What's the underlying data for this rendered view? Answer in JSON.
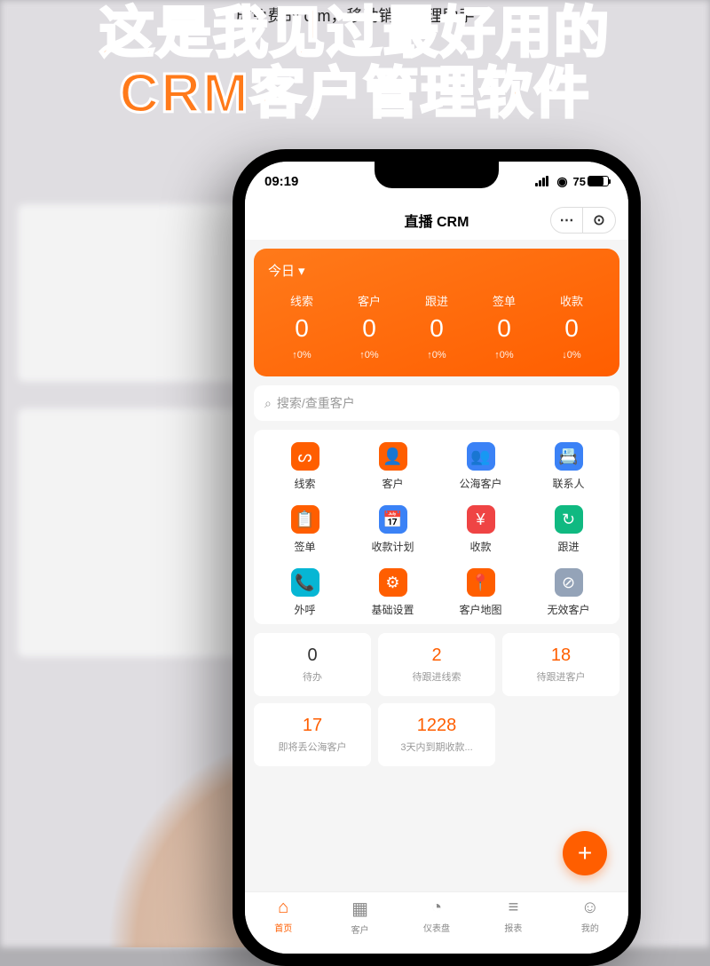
{
  "caption": "成免费的 crm，移动销售管理助手",
  "headline_l1": "这是我见过最好用的",
  "headline_l2": "CRM客户管理软件",
  "status": {
    "time": "09:19",
    "battery": "75"
  },
  "app_title": "直播 CRM",
  "hero": {
    "day": "今日",
    "stats": [
      {
        "label": "线索",
        "value": "0",
        "change": "↑0%"
      },
      {
        "label": "客户",
        "value": "0",
        "change": "↑0%"
      },
      {
        "label": "跟进",
        "value": "0",
        "change": "↑0%"
      },
      {
        "label": "签单",
        "value": "0",
        "change": "↑0%"
      },
      {
        "label": "收款",
        "value": "0",
        "change": "↓0%"
      }
    ]
  },
  "search_placeholder": "搜索/查重客户",
  "grid": [
    {
      "label": "线索",
      "bg": "#ff5e00",
      "glyph": "ᔕ"
    },
    {
      "label": "客户",
      "bg": "#ff5e00",
      "glyph": "👤"
    },
    {
      "label": "公海客户",
      "bg": "#3b82f6",
      "glyph": "👥"
    },
    {
      "label": "联系人",
      "bg": "#3b82f6",
      "glyph": "📇"
    },
    {
      "label": "签单",
      "bg": "#ff5e00",
      "glyph": "📋"
    },
    {
      "label": "收款计划",
      "bg": "#3b82f6",
      "glyph": "📅"
    },
    {
      "label": "收款",
      "bg": "#ef4444",
      "glyph": "¥"
    },
    {
      "label": "跟进",
      "bg": "#10b981",
      "glyph": "↻"
    },
    {
      "label": "外呼",
      "bg": "#06b6d4",
      "glyph": "📞"
    },
    {
      "label": "基础设置",
      "bg": "#ff5e00",
      "glyph": "⚙"
    },
    {
      "label": "客户地图",
      "bg": "#ff5e00",
      "glyph": "📍"
    },
    {
      "label": "无效客户",
      "bg": "#94a3b8",
      "glyph": "⊘"
    }
  ],
  "cards": [
    {
      "value": "0",
      "label": "待办",
      "cls": "c-black"
    },
    {
      "value": "2",
      "label": "待跟进线索",
      "cls": "c-orange"
    },
    {
      "value": "18",
      "label": "待跟进客户",
      "cls": "c-orange"
    },
    {
      "value": "17",
      "label": "即将丢公海客户",
      "cls": "c-orange"
    },
    {
      "value": "1228",
      "label": "3天内到期收款...",
      "cls": "c-orange"
    }
  ],
  "tabs": [
    {
      "label": "首页",
      "glyph": "⌂",
      "active": true
    },
    {
      "label": "客户",
      "glyph": "▦",
      "active": false
    },
    {
      "label": "仪表盘",
      "glyph": "◔",
      "active": false
    },
    {
      "label": "报表",
      "glyph": "≡",
      "active": false
    },
    {
      "label": "我的",
      "glyph": "☺",
      "active": false
    }
  ],
  "fab": "+"
}
